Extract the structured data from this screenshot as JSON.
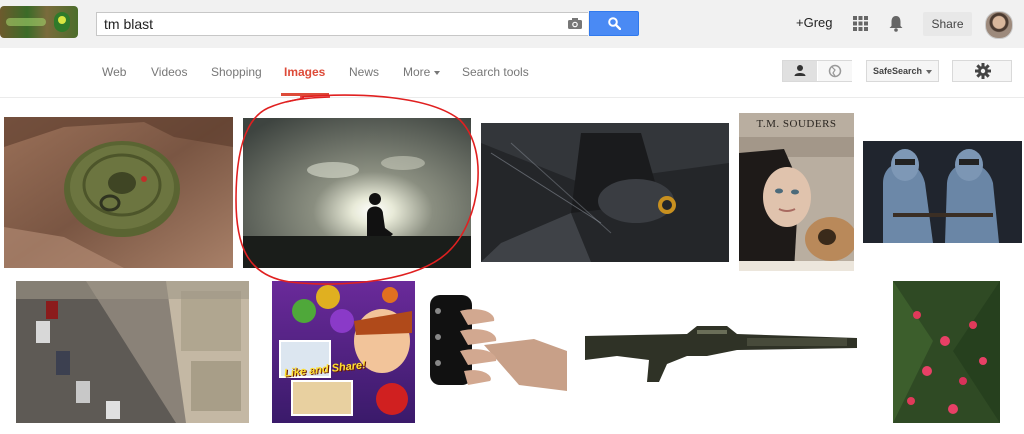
{
  "search": {
    "query": "tm blast"
  },
  "header": {
    "user": "+Greg",
    "share_label": "Share"
  },
  "nav": {
    "items": [
      "Web",
      "Videos",
      "Shopping",
      "Images",
      "News",
      "More",
      "Search tools"
    ],
    "active": "Images",
    "safesearch_label": "SafeSearch"
  },
  "results": {
    "book_cover_text": "T.M. SOUDERS",
    "game_banner_text": "Like and Share!"
  },
  "colors": {
    "accent_red": "#dd4b39",
    "search_blue": "#4a8af4",
    "annotation_red": "#e02020"
  }
}
